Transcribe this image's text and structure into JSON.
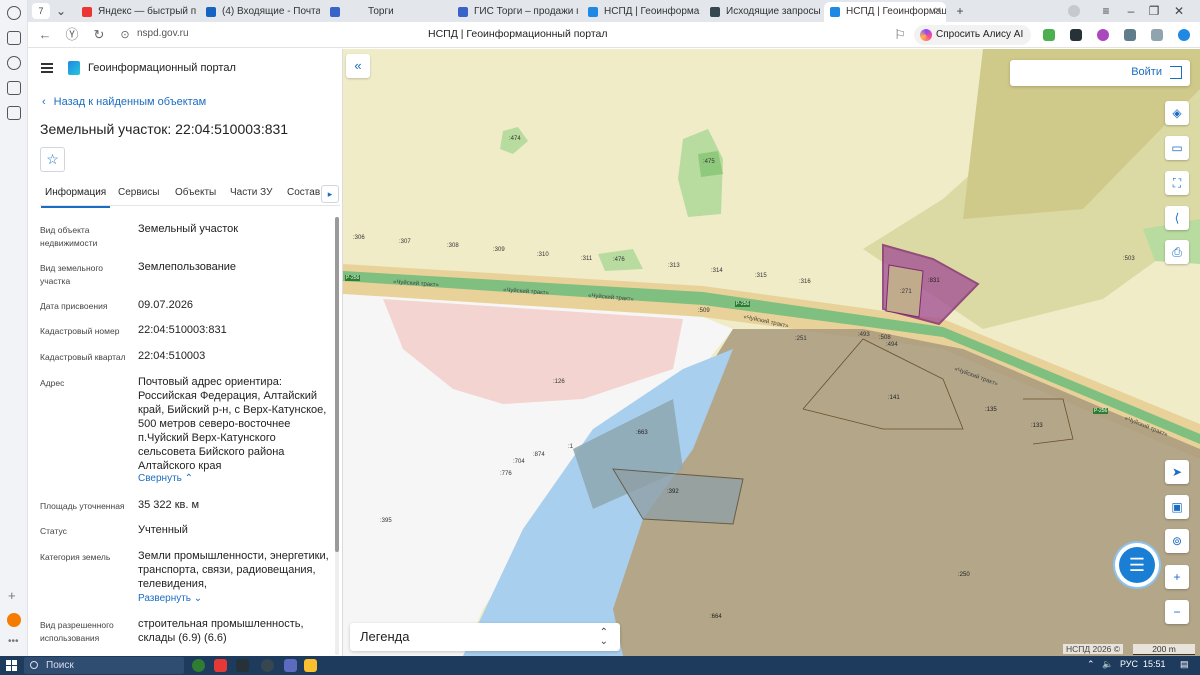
{
  "browser": {
    "tab_count": "7",
    "tabs": [
      {
        "label": "Яндекс — быстрый поиск",
        "color": "#e33"
      },
      {
        "label": "(4) Входящие - Почта Ма",
        "color": "#1565c0"
      },
      {
        "label": "Торги",
        "color": "#3a63c9"
      },
      {
        "label": "ГИС Торги – продажи гос",
        "color": "#3a63c9"
      },
      {
        "label": "НСПД | Геоинформацион",
        "color": "#1e88e5"
      },
      {
        "label": "Исходящие запросы СМЭ",
        "color": "#37474f"
      },
      {
        "label": "НСПД | Геоинформац",
        "color": "#1e88e5"
      }
    ],
    "url": "nspd.gov.ru",
    "page_title": "НСПД | Геоинформационный портал",
    "alisa_label": "Спросить Алису AI"
  },
  "panel": {
    "portal_title": "Геоинформационный портал",
    "back_label": "Назад к найденным объектам",
    "parcel_title": "Земельный участок: 22:04:510003:831",
    "tabs": [
      "Информация",
      "Сервисы",
      "Объекты",
      "Части ЗУ",
      "Состав"
    ],
    "fields": [
      {
        "label": "Вид объекта недвижимости",
        "value": "Земельный участок"
      },
      {
        "label": "Вид земельного участка",
        "value": "Землепользование"
      },
      {
        "label": "Дата присвоения",
        "value": "09.07.2026"
      },
      {
        "label": "Кадастровый номер",
        "value": "22:04:510003:831"
      },
      {
        "label": "Кадастровый квартал",
        "value": "22:04:510003"
      },
      {
        "label": "Адрес",
        "value": "Почтовый адрес ориентира: Российская Федерация, Алтайский край, Бийский р-н, с Верх-Катунское, 500 метров северо-восточнее п.Чуйский Верх-Катунского сельсовета Бийского района Алтайского края"
      },
      {
        "label": "Площадь уточненная",
        "value": "35 322 кв. м"
      },
      {
        "label": "Статус",
        "value": "Учтенный"
      },
      {
        "label": "Категория земель",
        "value": "Земли промышленности, энергетики, транспорта, связи, радиовещания, телевидения,"
      },
      {
        "label": "Вид разрешенного использования",
        "value": "строительная промышленность, склады (6.9) (6.6)"
      }
    ],
    "collapse_label": "Свернуть",
    "expand_label": "Развернуть"
  },
  "map": {
    "login_label": "Войти",
    "legend_label": "Легенда",
    "copyright": "НСПД 2026 ©",
    "scale": "200 m",
    "road_label": "«Чуйский тракт»",
    "road_code": "Р-256",
    "parcel_labels": {
      "p474": ":474",
      "p475": ":475",
      "p476": ":476",
      "p306": ":306",
      "p307": ":307",
      "p308": ":308",
      "p309": ":309",
      "p310": ":310",
      "p311": ":311",
      "p313": ":313",
      "p314": ":314",
      "p315": ":315",
      "p316": ":316",
      "p271": ":271",
      "p831": ":831",
      "p251": ":251",
      "p493": ":493",
      "p508": ":508",
      "p494": ":494",
      "p141": ":141",
      "p135": ":135",
      "p133": ":133",
      "p663": ":663",
      "p392": ":392",
      "p250": ":250",
      "p664": ":664",
      "p503": ":503",
      "p395": ":395",
      "p704": ":704",
      "p874": ":874",
      "p776": ":776",
      "p509": ":509",
      "p126": ":126",
      "p1": ":1"
    },
    "colors": {
      "water": "#a9cfee",
      "forest": "#b8dba0",
      "field": "#f0ecc8",
      "selected": "#9b3b8a",
      "area": "#a89a7e"
    }
  },
  "taskbar": {
    "search_label": "Поиск",
    "lang": "РУС",
    "time": "15:51"
  }
}
